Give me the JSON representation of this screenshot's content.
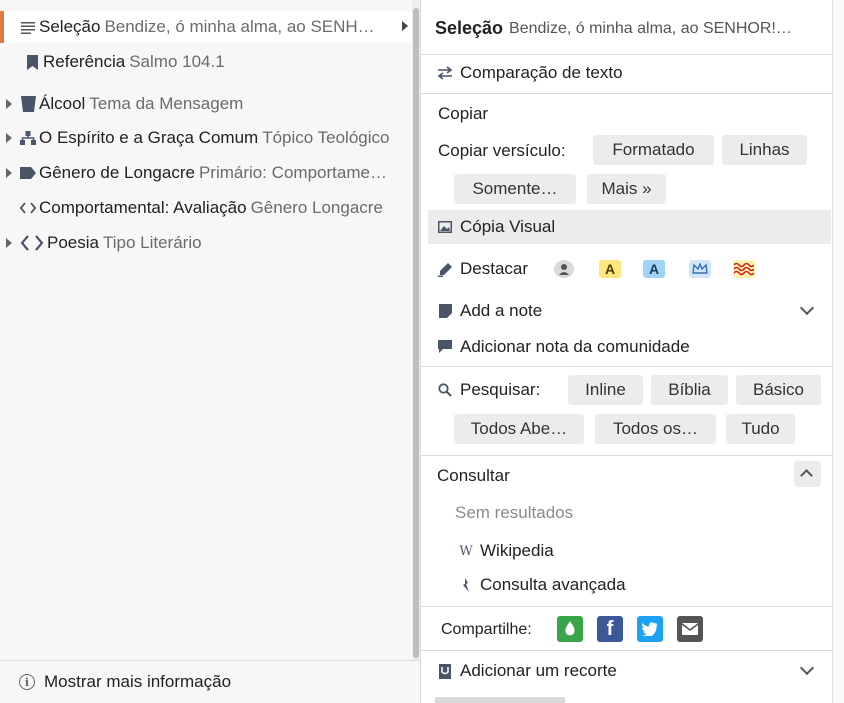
{
  "left": {
    "rows": [
      {
        "key": "Seleção",
        "value": "Bendize, ó minha alma, ao SENH…",
        "icon": "list-icon"
      },
      {
        "key": "Referência",
        "value": "Salmo 104.1",
        "icon": "bookmark-icon"
      },
      {
        "key": "Álcool",
        "value": "Tema da Mensagem",
        "icon": "cup-icon"
      },
      {
        "key": "O Espírito e a Graça Comum",
        "value": "Tópico Teológico",
        "icon": "hierarchy-icon"
      },
      {
        "key": "Gênero de Longacre",
        "value": "Primário: Comportame…",
        "icon": "tag-icon"
      },
      {
        "key": "Comportamental: Avaliação",
        "value": "Gênero Longacre",
        "icon": "code-icon"
      },
      {
        "key": "Poesia",
        "value": "Tipo Literário",
        "icon": "code-icon"
      }
    ],
    "footer": "Mostrar mais informação"
  },
  "right": {
    "header": {
      "key": "Seleção",
      "value": "Bendize, ó minha alma, ao SENHOR!…"
    },
    "compare": "Comparação de texto",
    "copy": {
      "title": "Copiar",
      "verse_label": "Copiar versículo:",
      "buttons": [
        "Formatado",
        "Linhas",
        "Somente…",
        "Mais »"
      ]
    },
    "visual_copy": "Cópia Visual",
    "highlight_label": "Destacar",
    "add_note": "Add a note",
    "community_note": "Adicionar nota da comunidade",
    "search": {
      "label": "Pesquisar:",
      "buttons": [
        "Inline",
        "Bíblia",
        "Básico",
        "Todos Abe…",
        "Todos os…",
        "Tudo"
      ]
    },
    "consult": {
      "title": "Consultar",
      "no_results": "Sem resultados",
      "wikipedia": "Wikipedia",
      "advanced": "Consulta avançada"
    },
    "share_label": "Compartilhe:",
    "add_clipping": "Adicionar um recorte"
  },
  "colors": {
    "accent": "#e07a3c",
    "facebook": "#3b5998",
    "twitter": "#1da1f2",
    "logos": "#3aa44a"
  }
}
